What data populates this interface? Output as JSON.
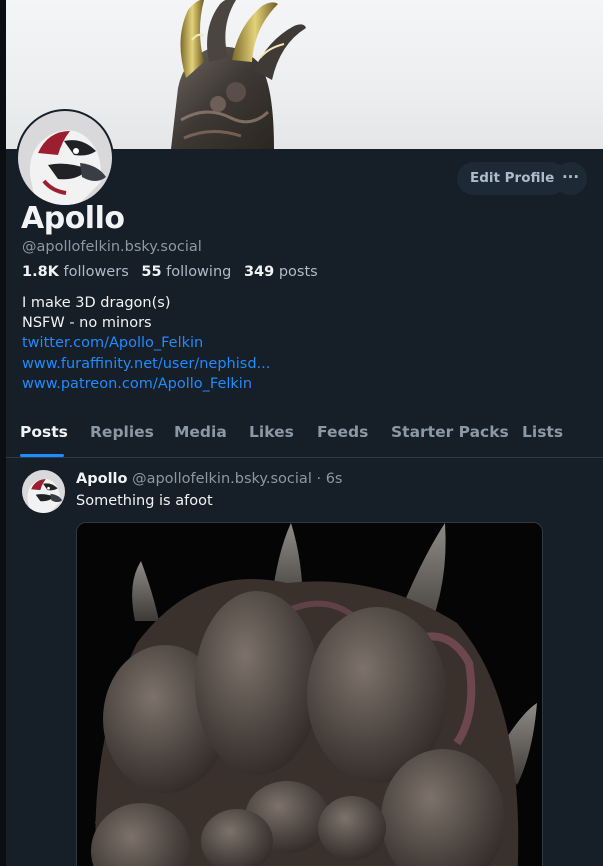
{
  "profile": {
    "display_name": "Apollo",
    "handle": "@apollofelkin.bsky.social",
    "stats": {
      "followers_count": "1.8K",
      "followers_label": "followers",
      "following_count": "55",
      "following_label": "following",
      "posts_count": "349",
      "posts_label": "posts"
    },
    "bio": {
      "line1": "I make 3D dragon(s)",
      "line2": "NSFW - no minors",
      "links": [
        "twitter.com/Apollo_Felkin",
        "www.furaffinity.net/user/nephisd...",
        "www.patreon.com/Apollo_Felkin"
      ]
    }
  },
  "actions": {
    "edit_profile": "Edit Profile",
    "more": "···"
  },
  "tabs": [
    "Posts",
    "Replies",
    "Media",
    "Likes",
    "Feeds",
    "Starter Packs",
    "Lists"
  ],
  "active_tab": "Posts",
  "post": {
    "author": "Apollo",
    "handle": "@apollofelkin.bsky.social",
    "separator": "·",
    "time": "6s",
    "text": "Something is afoot"
  },
  "colors": {
    "background": "#161e27",
    "accent": "#208bfe",
    "muted_text": "#8b98a5",
    "button_bg": "#1e2936"
  },
  "icons": {
    "more": "ellipsis-icon"
  }
}
